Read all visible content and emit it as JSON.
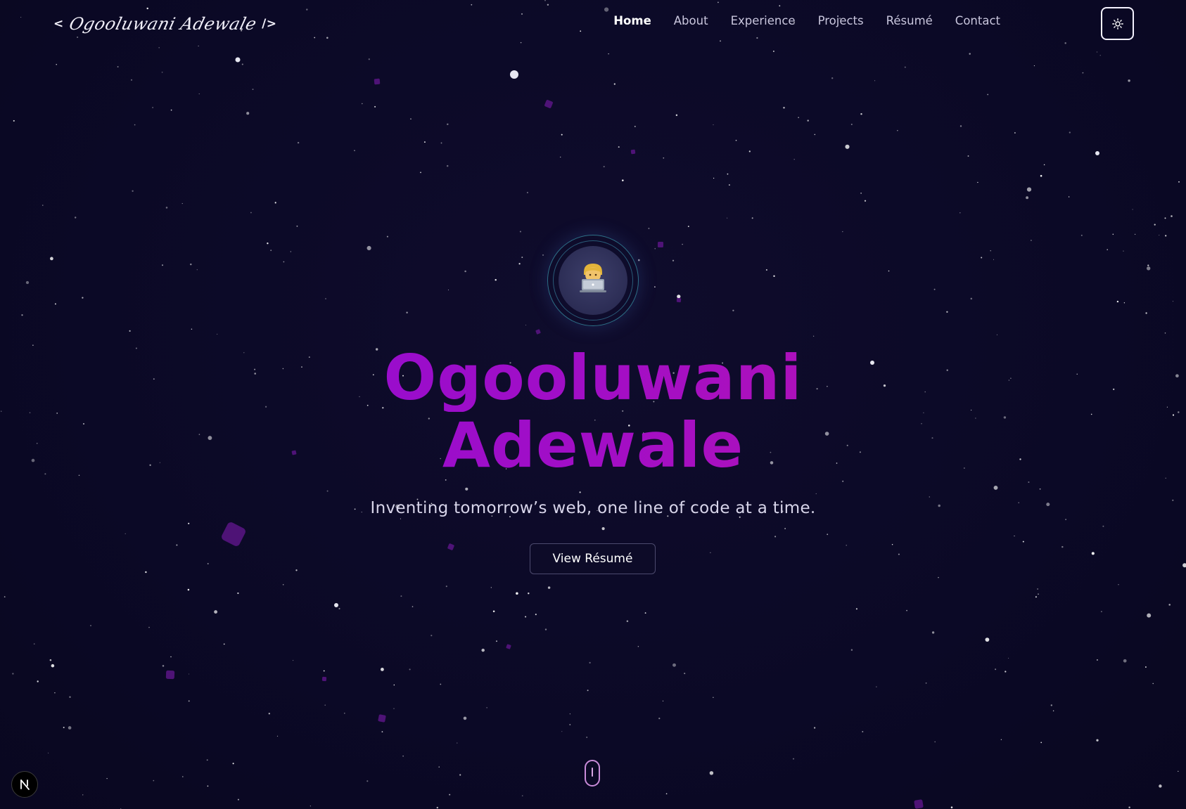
{
  "header": {
    "logo": {
      "open": "<",
      "name": "Ogooluwani Adewale",
      "close": "/>"
    },
    "nav": [
      "Home",
      "About",
      "Experience",
      "Projects",
      "Résumé",
      "Contact"
    ],
    "active_nav": "Home",
    "theme_toggle_icon": "sun-icon"
  },
  "hero": {
    "avatar_icon": "technologist-emoji",
    "title_line1": "Ogooluwani",
    "title_line2": "Adewale",
    "tagline": "Inventing tomorrow’s web, one line of code at a time.",
    "cta": "View Résumé",
    "scroll_icon": "mouse-scroll-icon"
  },
  "dev_badge": {
    "label": "N",
    "icon": "nextjs-logo-icon"
  },
  "colors": {
    "background": "#0b0926",
    "title_gradient_start": "#8a0bd6",
    "title_gradient_end": "#c015a8",
    "accent_ring": "#2d6f86",
    "scroll_indicator": "#c98bd9"
  }
}
